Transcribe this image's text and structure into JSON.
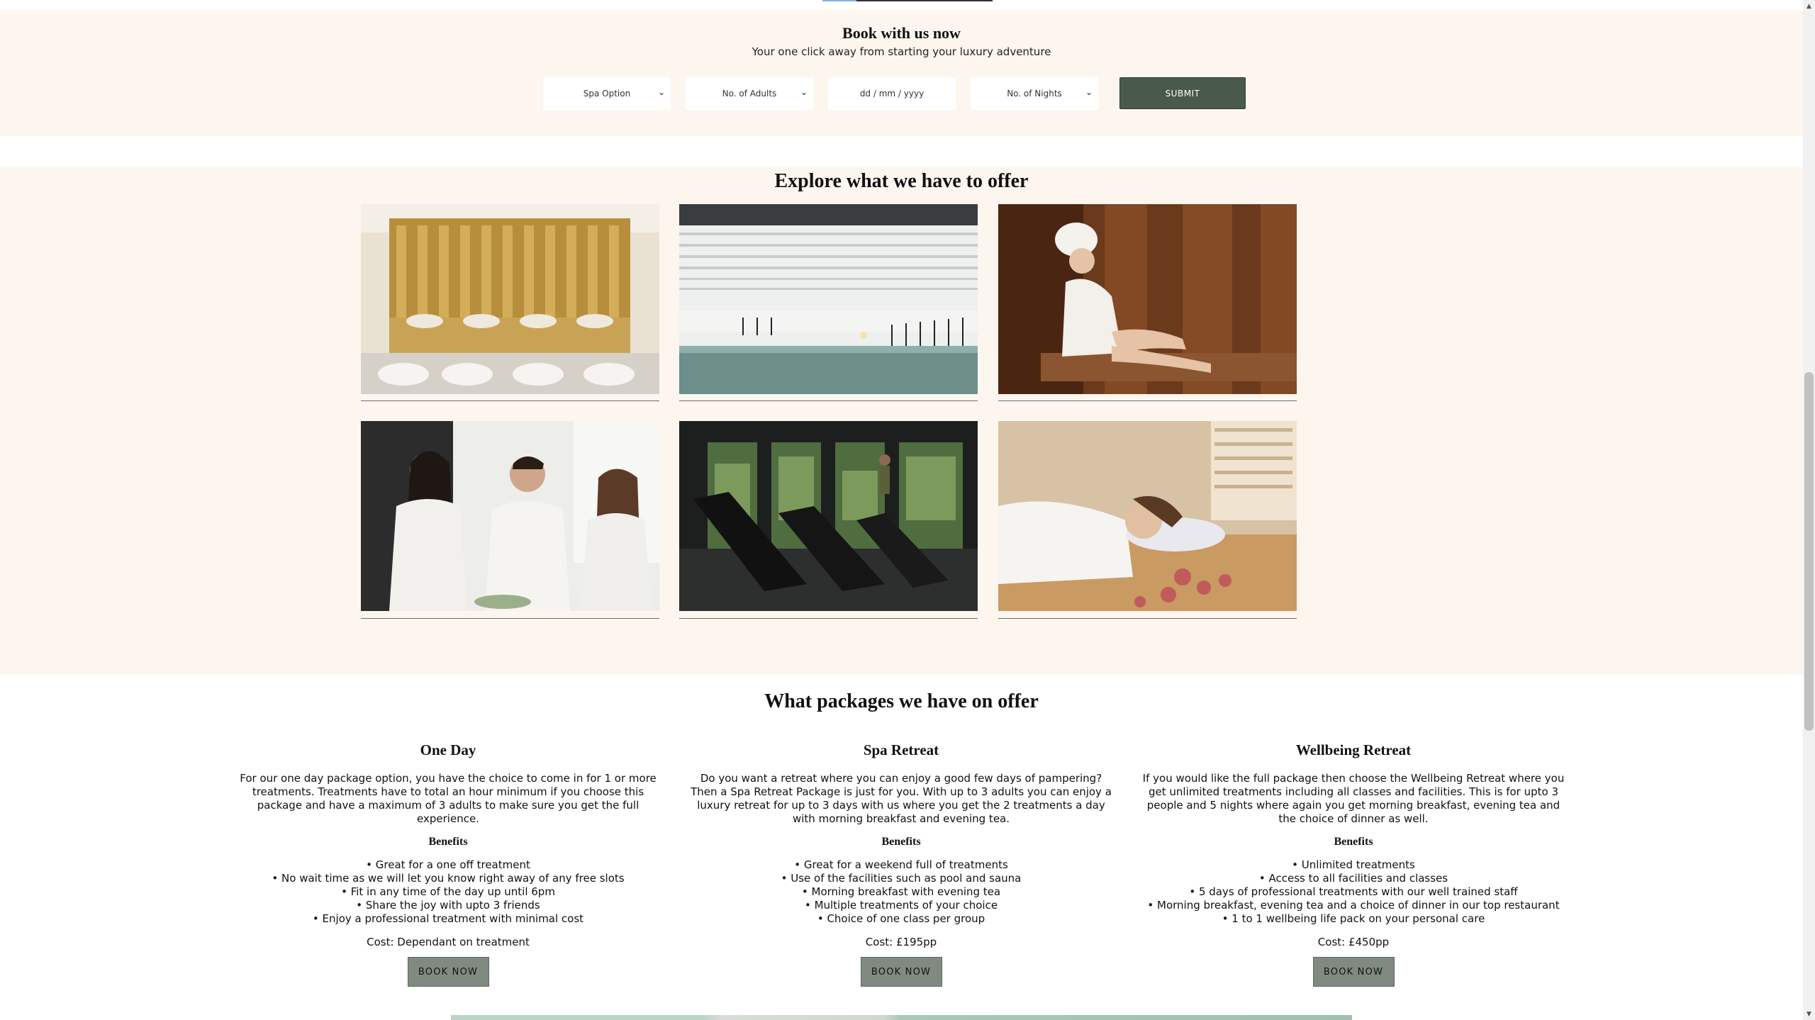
{
  "booking": {
    "title": "Book with us now",
    "subtitle": "Your one click away from starting your luxury adventure",
    "spa_option": "Spa Option",
    "adults": "No. of Adults",
    "date_placeholder": "dd / mm / yyyy",
    "nights": "No. of Nights",
    "submit": "SUBMIT"
  },
  "explore": {
    "title": "Explore what we have to offer",
    "tiles": [
      "pedicure-lounge",
      "indoor-pool",
      "sauna",
      "friends-in-robes",
      "gym-treadmills",
      "massage-relaxation"
    ]
  },
  "packages": {
    "title": "What packages we have on offer",
    "benefits_label": "Benefits",
    "book_label": "BOOK NOW",
    "items": [
      {
        "name": "One Day",
        "description": "For our one day package option, you have the choice to come in for 1 or more treatments. Treatments have to total an hour minimum if you choose this package and have a maximum of 3 adults to make sure you get the full experience.",
        "benefits": [
          "Great for a one off treatment",
          "No wait time as we will let you know right away of any free slots",
          "Fit in any time of the day up until 6pm",
          "Share the joy with upto 3 friends",
          "Enjoy a professional treatment with minimal cost"
        ],
        "cost": "Cost: Dependant on treatment"
      },
      {
        "name": "Spa Retreat",
        "description": "Do you want a retreat where you can enjoy a good few days of pampering? Then a Spa Retreat Package is just for you. With up to 3 adults you can enjoy a luxury retreat for up to 3 days with us where you get the 2 treatments a day with morning breakfast and evening tea.",
        "benefits": [
          "Great for a weekend full of treatments",
          "Use of the facilities such as pool and sauna",
          "Morning breakfast with evening tea",
          "Multiple treatments of your choice",
          "Choice of one class per group"
        ],
        "cost": "Cost: £195pp"
      },
      {
        "name": "Wellbeing Retreat",
        "description": "If you would like the full package then choose the Wellbeing Retreat where you get unlimited treatments including all classes and facilities. This is for upto 3 people and 5 nights where again you get morning breakfast, evening tea and the choice of dinner as well.",
        "benefits": [
          "Unlimited treatments",
          "Access to all facilities and classes",
          "5 days of professional treatments with our well trained staff",
          "Morning breakfast, evening tea and a choice of dinner in our top restaurant",
          "1 to 1 wellbeing life pack on your personal care"
        ],
        "cost": "Cost: £450pp"
      }
    ]
  }
}
